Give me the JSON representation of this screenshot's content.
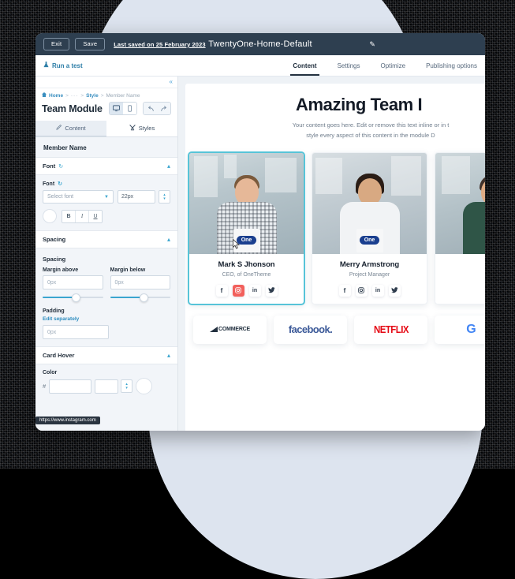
{
  "topbar": {
    "exit_label": "Exit",
    "save_label": "Save",
    "last_saved": "Last saved on 25 February 2023",
    "page_title": "TwentyOne-Home-Default",
    "edit_icon": "pencil-icon"
  },
  "subbar": {
    "run_test_label": "Run a test",
    "run_test_icon": "flask-icon",
    "tabs": [
      {
        "label": "Content",
        "active": true
      },
      {
        "label": "Settings",
        "active": false
      },
      {
        "label": "Optimize",
        "active": false
      },
      {
        "label": "Publishing options",
        "active": false
      }
    ]
  },
  "sidebar": {
    "collapse_icon": "collapse-panel-icon",
    "breadcrumb": {
      "home": "Home",
      "ellipsis": "···",
      "style": "Style",
      "current": "Member Name",
      "separator": ">"
    },
    "module_title": "Team Module",
    "device_toggle": [
      {
        "icon": "desktop-icon",
        "active": true
      },
      {
        "icon": "mobile-icon",
        "active": false
      }
    ],
    "history": [
      {
        "icon": "undo-icon"
      },
      {
        "icon": "redo-icon"
      }
    ],
    "tabs": [
      {
        "label": "Content",
        "icon": "pencil-icon",
        "active": false
      },
      {
        "label": "Styles",
        "icon": "brush-icon",
        "active": true
      }
    ],
    "field_heading": "Member Name",
    "sections": [
      {
        "title": "Font",
        "refresh_icon": "refresh-icon",
        "caret_icon": "chevron-up-icon",
        "field_label": "Font",
        "font_select_value": "Select font",
        "font_size_value": "22px",
        "color_swatch": "#ffffff",
        "format_buttons": [
          "B",
          "I",
          "U"
        ]
      },
      {
        "title": "Spacing",
        "caret_icon": "chevron-up-icon",
        "sub_label": "Spacing",
        "margin_above_label": "Margin above",
        "margin_above_value": "0px",
        "margin_below_label": "Margin below",
        "margin_below_value": "0px",
        "padding_label": "Padding",
        "edit_separately_label": "Edit separately",
        "padding_value": "0px"
      },
      {
        "title": "Card Hover",
        "caret_icon": "chevron-up-icon",
        "color_label": "Color",
        "hash": "#",
        "hex_value": "",
        "opacity_value": ""
      }
    ],
    "tooltip": "https://www.instagram.com"
  },
  "canvas": {
    "hero_title": "Amazing Team I",
    "hero_text_line1": "Your content goes here. Edit or remove this text inline or in t",
    "hero_text_line2": "style every aspect of this content in the module D",
    "cards": [
      {
        "name": "Mark S Jhonson",
        "role": "CEO, of OneTheme",
        "badge": "One",
        "selected": true,
        "socials": [
          {
            "icon": "facebook-icon",
            "glyph": "f",
            "active": false
          },
          {
            "icon": "instagram-icon",
            "glyph": "▣",
            "active": true
          },
          {
            "icon": "linkedin-icon",
            "glyph": "in",
            "active": false
          },
          {
            "icon": "twitter-icon",
            "glyph": "ᴮ",
            "active": false
          }
        ]
      },
      {
        "name": "Merry Armstrong",
        "role": "Project Manager",
        "badge": "One",
        "selected": false,
        "socials": [
          {
            "icon": "facebook-icon",
            "glyph": "f",
            "active": false
          },
          {
            "icon": "instagram-icon",
            "glyph": "▣",
            "active": false
          },
          {
            "icon": "linkedin-icon",
            "glyph": "in",
            "active": false
          },
          {
            "icon": "twitter-icon",
            "glyph": "ᴮ",
            "active": false
          }
        ]
      },
      {
        "name": "",
        "role": "",
        "badge": "",
        "selected": false,
        "socials": []
      }
    ],
    "logos": [
      {
        "name": "bigcommerce-logo",
        "text": "COMMERCE"
      },
      {
        "name": "facebook-logo",
        "text": "facebook."
      },
      {
        "name": "netflix-logo",
        "text": "NETFLIX"
      },
      {
        "name": "google-logo",
        "text": "G"
      }
    ]
  },
  "colors": {
    "topbar_bg": "#2e3f50",
    "accent_blue": "#3aa5cf",
    "link_blue": "#2f8ec0",
    "selection_teal": "#57c4d8",
    "hot_red": "#f2605c",
    "circle_bg": "#dde4ef"
  }
}
